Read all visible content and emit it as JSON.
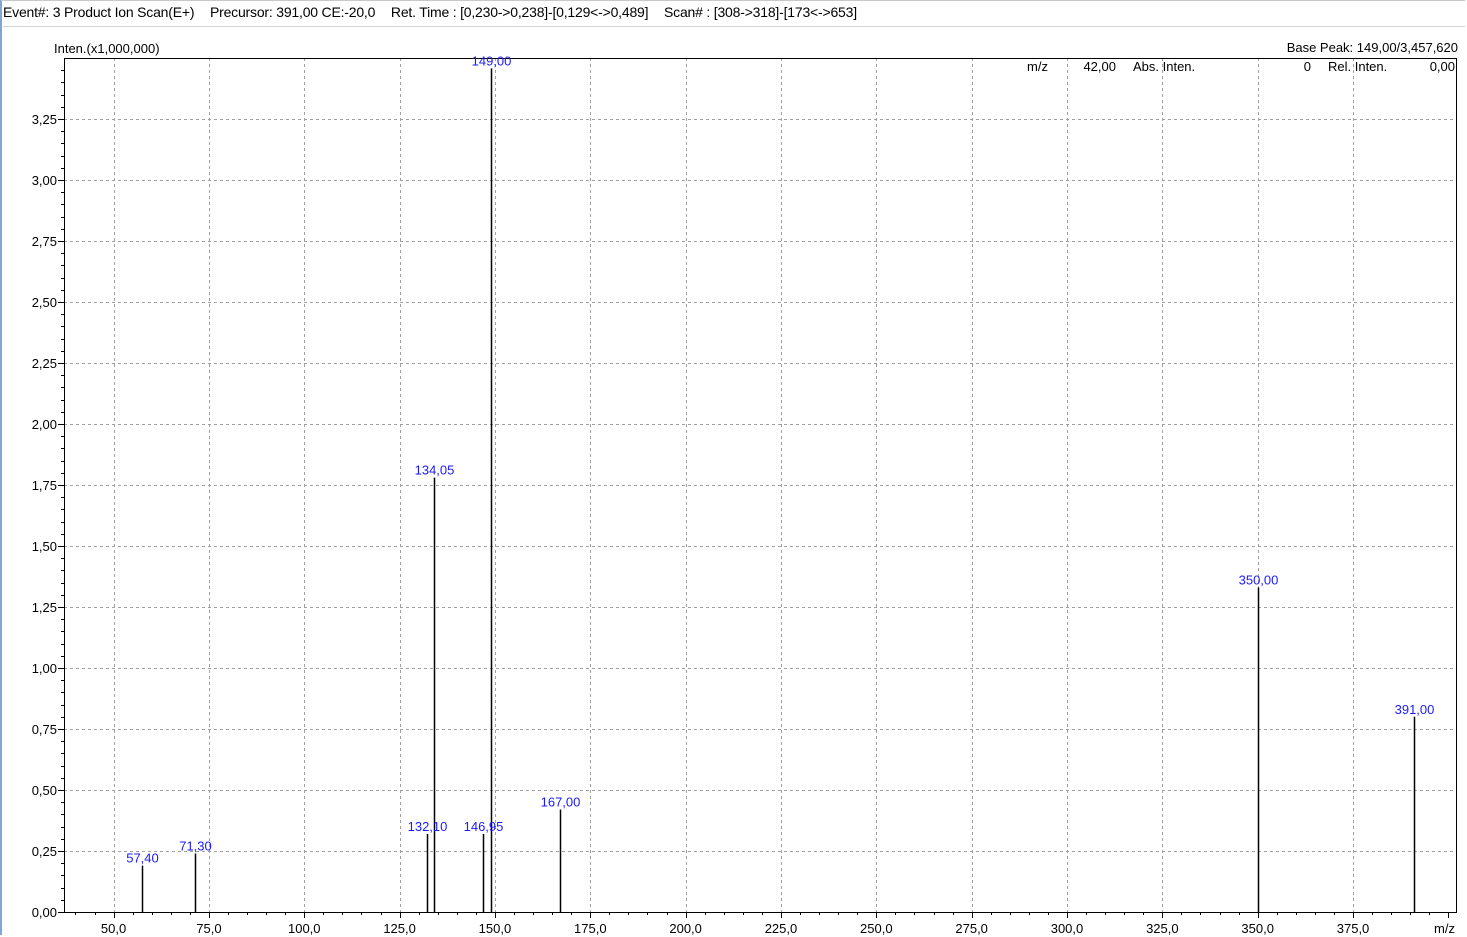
{
  "header": {
    "event": "Event#: 3 Product Ion Scan(E+)",
    "precursor": "Precursor: 391,00 CE:-20,0",
    "ret_time": "Ret. Time : [0,230->0,238]-[0,129<->0,489]",
    "scan": "Scan# : [308->318]-[173<->653]"
  },
  "readout": {
    "mz_label": "m/z",
    "mz_value": "42,00",
    "abs_label": "Abs. Inten.",
    "abs_value": "0",
    "rel_label": "Rel. Inten.",
    "rel_value": "0,00"
  },
  "colors": {
    "axis": "#000000",
    "grid": "#a0a0a0",
    "peak": "#000000",
    "peak_label": "#1a1aff"
  },
  "chart_data": {
    "type": "bar",
    "title": "",
    "ylabel": "Inten.(x1,000,000)",
    "xlabel": "m/z",
    "base_peak": "Base Peak: 149,00/3,457,620",
    "xlim": [
      37.0,
      402.0
    ],
    "ylim": [
      0,
      3.5
    ],
    "grid": true,
    "x_ticks": [
      50,
      75,
      100,
      125,
      150,
      175,
      200,
      225,
      250,
      275,
      300,
      325,
      350,
      375
    ],
    "x_tick_labels": [
      "50,0",
      "75,0",
      "100,0",
      "125,0",
      "150,0",
      "175,0",
      "200,0",
      "225,0",
      "250,0",
      "275,0",
      "300,0",
      "325,0",
      "350,0",
      "375,0"
    ],
    "y_ticks": [
      0,
      0.25,
      0.5,
      0.75,
      1.0,
      1.25,
      1.5,
      1.75,
      2.0,
      2.25,
      2.5,
      2.75,
      3.0,
      3.25
    ],
    "y_tick_labels": [
      "0,00",
      "0,25",
      "0,50",
      "0,75",
      "1,00",
      "1,25",
      "1,50",
      "1,75",
      "2,00",
      "2,25",
      "2,50",
      "2,75",
      "3,00",
      "3,25"
    ],
    "peaks": [
      {
        "mz": 57.4,
        "intensity": 0.19,
        "label": "57,40"
      },
      {
        "mz": 71.3,
        "intensity": 0.24,
        "label": "71,30"
      },
      {
        "mz": 132.1,
        "intensity": 0.32,
        "label": "132,10"
      },
      {
        "mz": 134.05,
        "intensity": 1.78,
        "label": "134,05"
      },
      {
        "mz": 146.95,
        "intensity": 0.32,
        "label": "146,95"
      },
      {
        "mz": 149.0,
        "intensity": 3.4576,
        "label": "149,00"
      },
      {
        "mz": 167.0,
        "intensity": 0.42,
        "label": "167,00"
      },
      {
        "mz": 350.0,
        "intensity": 1.33,
        "label": "350,00"
      },
      {
        "mz": 391.0,
        "intensity": 0.8,
        "label": "391,00"
      }
    ]
  }
}
